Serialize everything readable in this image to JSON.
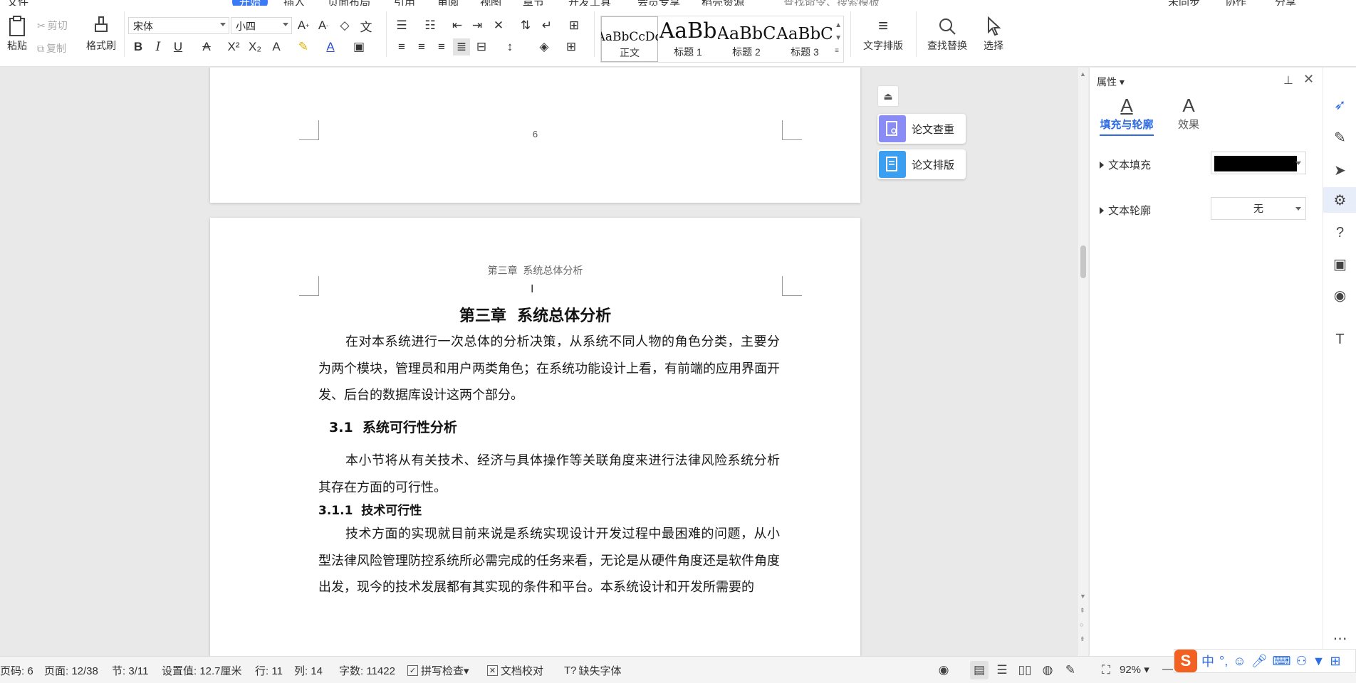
{
  "menu": {
    "tabs": [
      "文件",
      "开始",
      "插入",
      "页面布局",
      "引用",
      "审阅",
      "视图",
      "章节",
      "开发工具",
      "会员专享",
      "稻壳资源"
    ],
    "search": "查找命令、搜索模板",
    "right": [
      "未同步",
      "协作",
      "分享"
    ]
  },
  "ribbon": {
    "paste": "粘贴",
    "cut": "剪切",
    "copy": "复制",
    "format_painter": "格式刷",
    "font_name": "宋体",
    "font_size": "小四",
    "styles": [
      {
        "sample": "AaBbCcDd",
        "label": "正文"
      },
      {
        "sample": "AaBb",
        "label": "标题 1"
      },
      {
        "sample": "AaBbC",
        "label": "标题 2"
      },
      {
        "sample": "AaBbC",
        "label": "标题 3"
      }
    ],
    "text_layout": "文字排版",
    "find_replace": "查找替换",
    "select": "选择"
  },
  "document": {
    "page_number": "6",
    "header_text": "第三章  系统总体分析",
    "chapter_title": "第三章  系统总体分析",
    "para1": "在对本系统进行一次总体的分析决策，从系统不同人物的角色分类，主要分为两个模块，管理员和用户两类角色；在系统功能设计上看，有前端的应用界面开发、后台的数据库设计这两个部分。",
    "section_31": "3.1  系统可行性分析",
    "para2": "本小节将从有关技术、经济与具体操作等关联角度来进行法律风险系统分析其存在方面的可行性。",
    "section_311": "3.1.1  技术可行性",
    "para3": "技术方面的实现就目前来说是系统实现设计开发过程中最困难的问题，从小型法律风险管理防控系统所必需完成的任务来看，无论是从硬件角度还是软件角度出发，现今的技术发展都有其实现的条件和平台。本系统设计和开发所需要的"
  },
  "paper_tools": {
    "check": "论文查重",
    "layout": "论文排版"
  },
  "properties": {
    "title": "属性",
    "tabs": [
      "填充与轮廓",
      "效果"
    ],
    "text_fill_label": "文本填充",
    "text_fill_color": "#000000",
    "text_outline_label": "文本轮廓",
    "text_outline_value": "无"
  },
  "status": {
    "page_code": "页码: 6",
    "page": "页面: 12/38",
    "section": "节: 3/11",
    "setting": "设置值: 12.7厘米",
    "row": "行: 11",
    "col": "列: 14",
    "word_count": "字数: 11422",
    "spell_check": "拼写检查",
    "doc_proof": "文档校对",
    "missing_fonts": "缺失字体",
    "zoom": "92%"
  },
  "ime": {
    "mode": "中"
  },
  "colors": {
    "accent": "#2d6ae3",
    "paper_check_icon": "#8a8cf5",
    "paper_layout_icon": "#3a9ff0",
    "ime_logo": "#f26122"
  }
}
